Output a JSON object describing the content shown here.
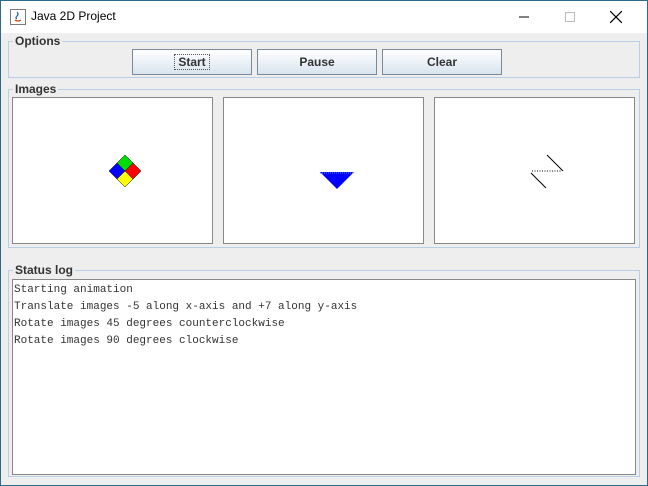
{
  "window": {
    "title": "Java 2D Project",
    "controls": {
      "minimize": "—",
      "maximize": "☐",
      "close": "✕"
    }
  },
  "options": {
    "legend": "Options",
    "buttons": {
      "start": "Start",
      "pause": "Pause",
      "clear": "Clear"
    }
  },
  "images": {
    "legend": "Images",
    "colors": {
      "green": "#00dd00",
      "red": "#ff0000",
      "blue": "#0000ff",
      "yellow": "#ffff00"
    }
  },
  "status": {
    "legend": "Status log",
    "lines": [
      "Starting animation",
      "Translate images -5 along x-axis and +7 along y-axis",
      "Rotate images 45 degrees counterclockwise",
      "Rotate images 90 degrees clockwise"
    ]
  },
  "theme": {
    "border": "#b8cfe5",
    "background": "#eeeeee"
  }
}
